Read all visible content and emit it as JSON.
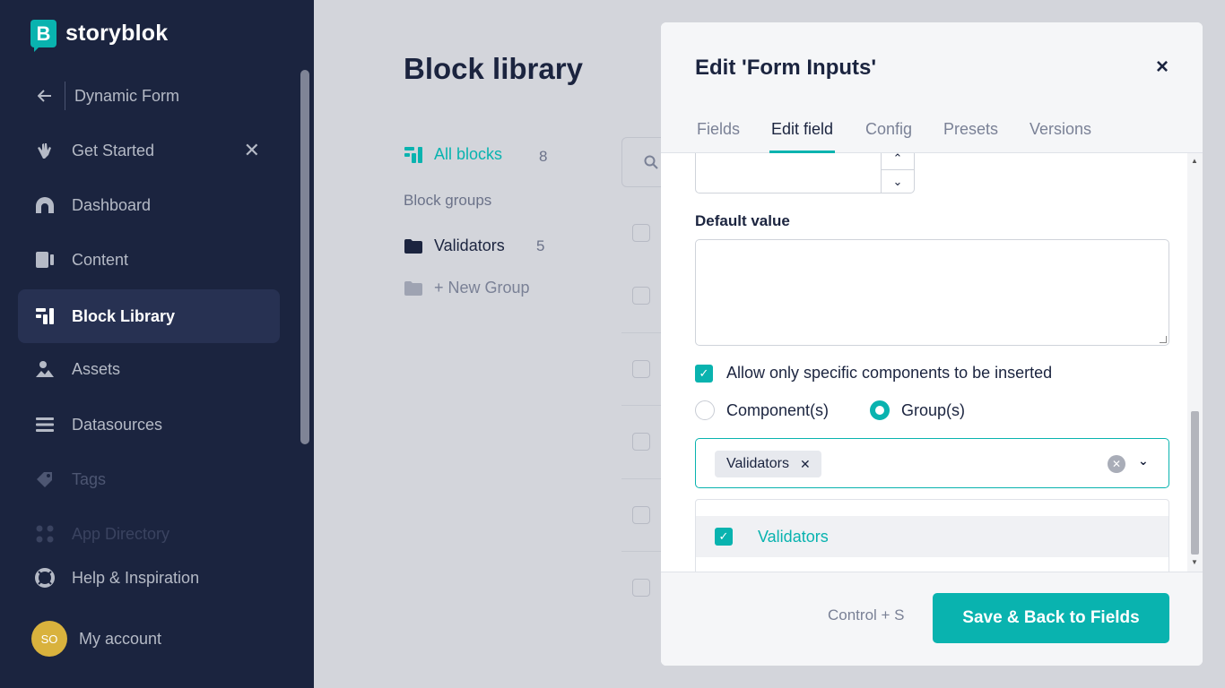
{
  "brand": {
    "name": "storyblok",
    "mark": "B",
    "color": "#09b3af"
  },
  "sidebar": {
    "back": {
      "label": "Dynamic Form",
      "icon": "arrow-left-icon"
    },
    "items": [
      {
        "label": "Get Started",
        "icon": "hand-wave-icon"
      },
      {
        "label": "Dashboard",
        "icon": "dashboard-icon"
      },
      {
        "label": "Content",
        "icon": "content-icon"
      },
      {
        "label": "Block Library",
        "icon": "blocks-icon",
        "active": true
      },
      {
        "label": "Assets",
        "icon": "image-icon"
      },
      {
        "label": "Datasources",
        "icon": "list-icon"
      },
      {
        "label": "Tags",
        "icon": "tag-icon"
      },
      {
        "label": "App Directory",
        "icon": "apps-icon"
      },
      {
        "label": "Help & Inspiration",
        "icon": "lifebuoy-icon"
      }
    ],
    "account": {
      "initials": "SO",
      "label": "My account"
    }
  },
  "page": {
    "title": "Block library",
    "all_blocks": {
      "label": "All blocks",
      "count": "8"
    },
    "groups_label": "Block groups",
    "groups": [
      {
        "label": "Validators",
        "count": "5"
      }
    ],
    "new_group": "+ New Group"
  },
  "modal": {
    "title": "Edit 'Form Inputs'",
    "close": "×",
    "tabs": [
      {
        "label": "Fields"
      },
      {
        "label": "Edit field",
        "active": true
      },
      {
        "label": "Config"
      },
      {
        "label": "Presets"
      },
      {
        "label": "Versions"
      }
    ],
    "default_value_label": "Default value",
    "allow_specific_label": "Allow only specific components to be inserted",
    "radio_components": "Component(s)",
    "radio_groups": "Group(s)",
    "selected_chip": "Validators",
    "dropdown_option": "Validators",
    "shortcut": "Control + S",
    "save_button": "Save & Back to Fields"
  }
}
